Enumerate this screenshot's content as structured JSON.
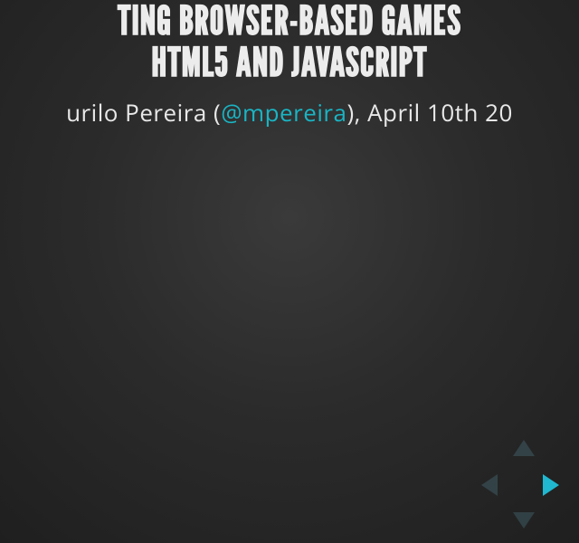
{
  "title": {
    "line1": "TING BROWSER-BASED GAMES ",
    "line2": "HTML5 AND JAVASCRIPT"
  },
  "byline": {
    "prefix": "urilo Pereira (",
    "handle": "@mpereira",
    "suffix": "), April 10th 20"
  },
  "controls": {
    "up_enabled": false,
    "down_enabled": false,
    "left_enabled": false,
    "right_enabled": true
  }
}
